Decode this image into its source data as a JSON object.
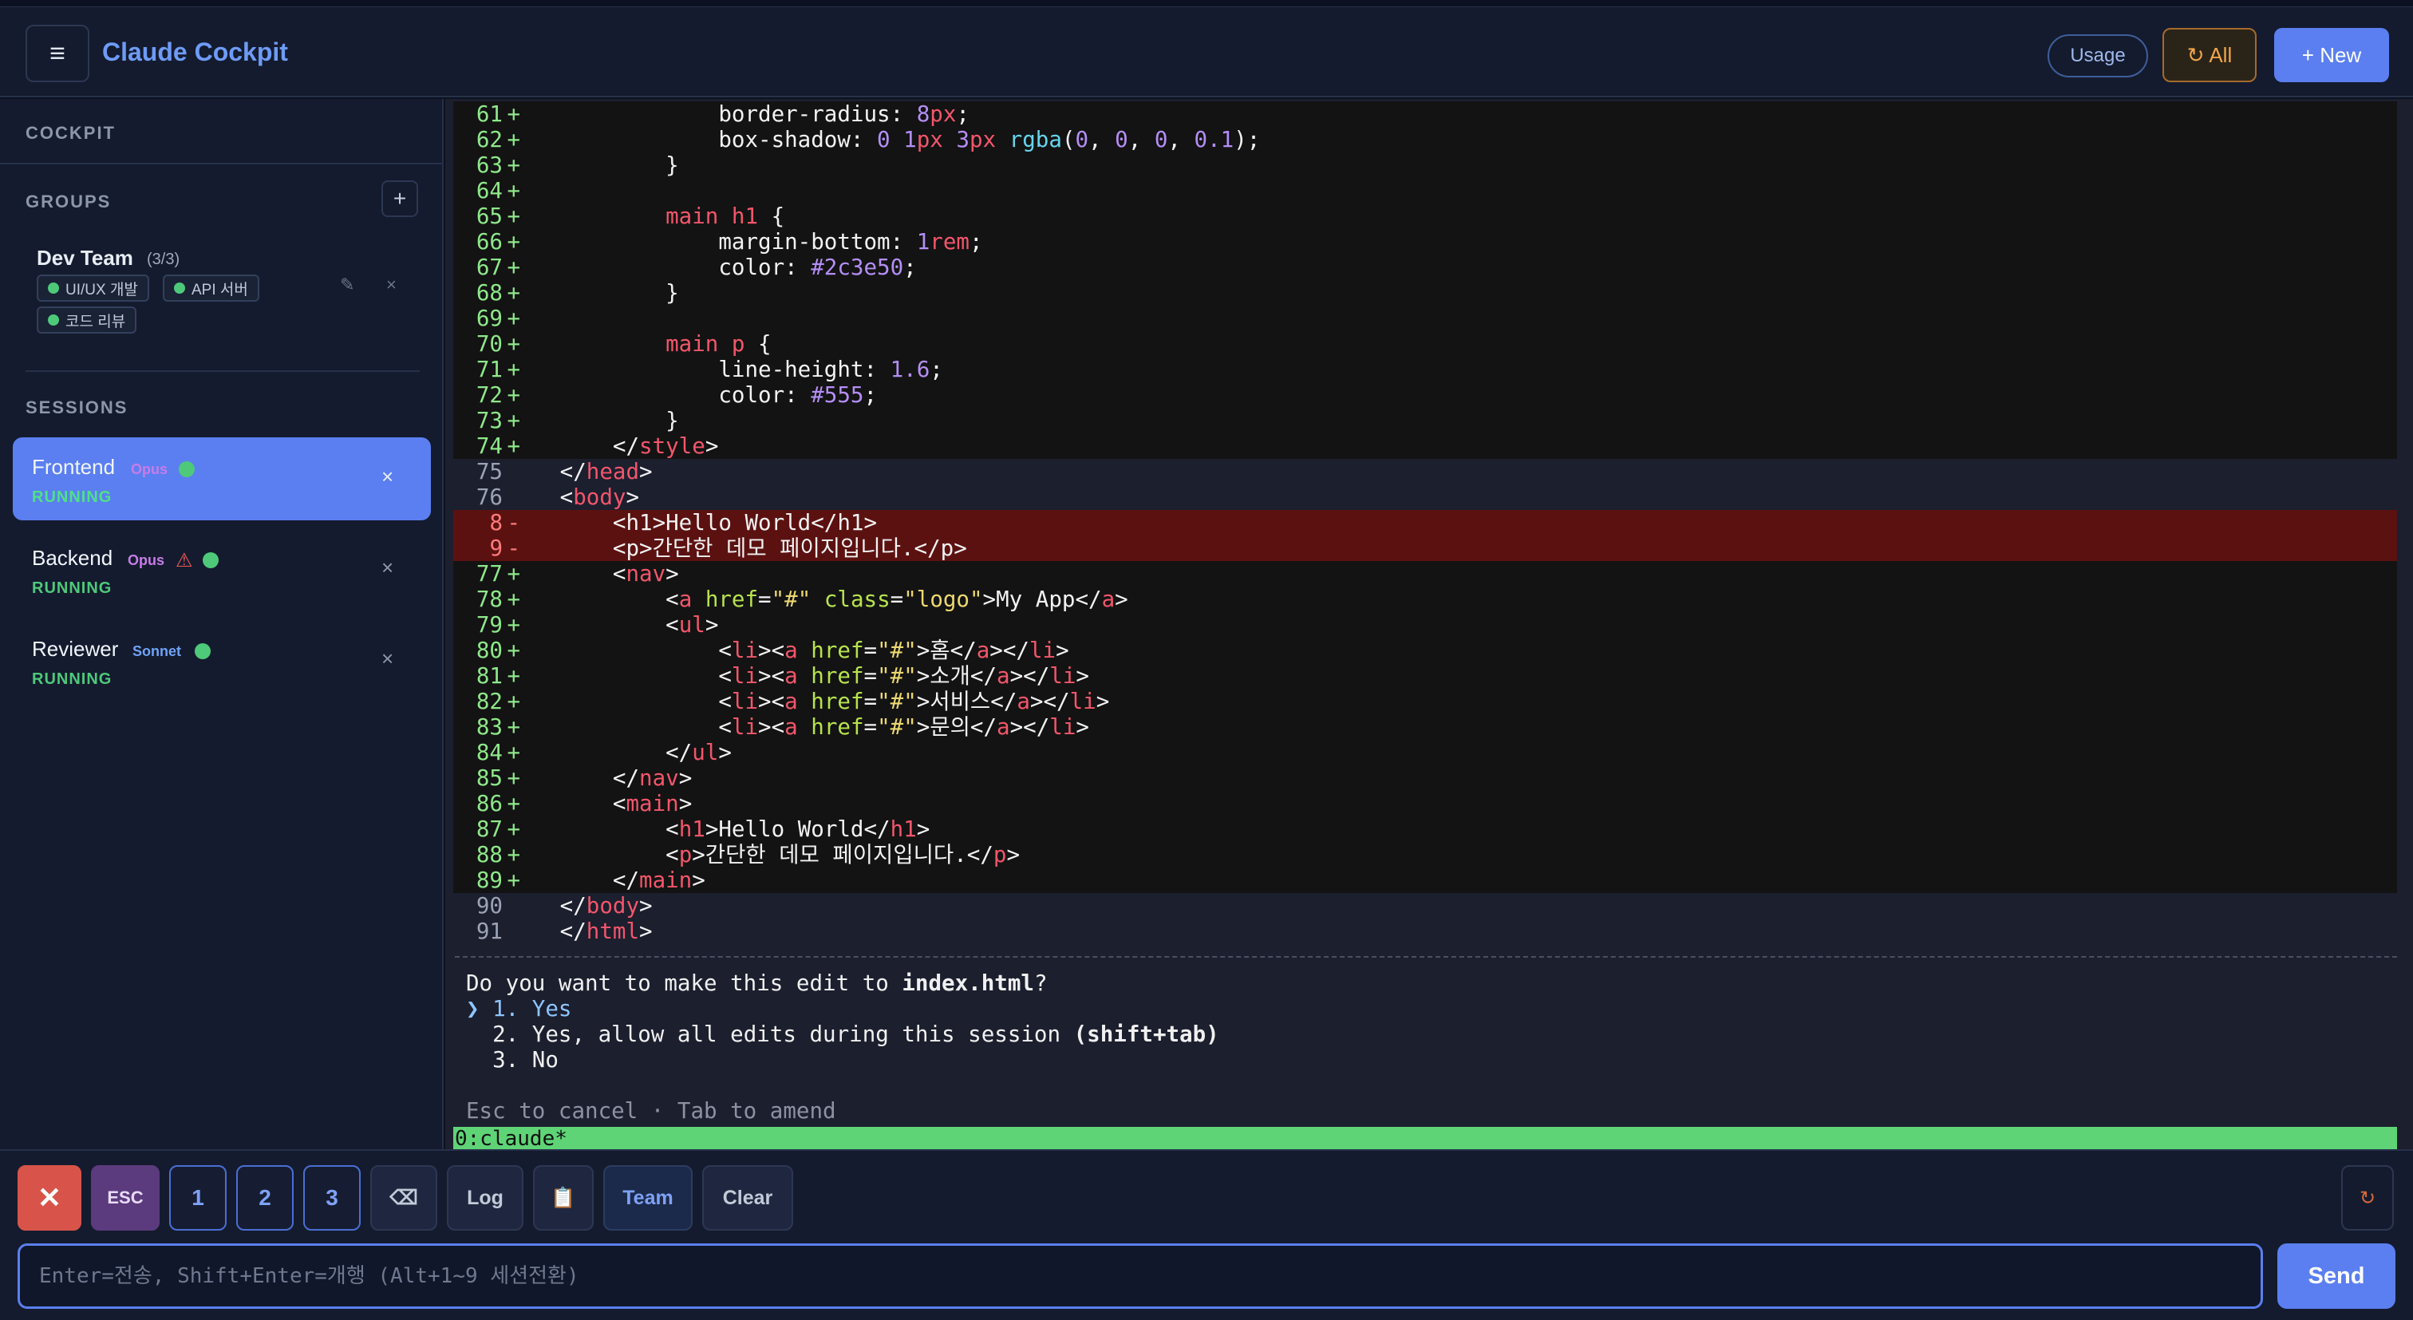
{
  "header": {
    "menu_icon": "menu-icon",
    "title": "Claude Cockpit",
    "usage_label": "Usage",
    "all_label": "↻ All",
    "new_label": "+ New",
    "accent": "#5b7ff0"
  },
  "sidebar": {
    "cockpit_label": "COCKPIT",
    "groups_label": "GROUPS",
    "add_group": "+",
    "group": {
      "name": "Dev Team",
      "count": "(3/3)",
      "chips": [
        "UI/UX 개발",
        "API 서버",
        "코드 리뷰"
      ],
      "edit_icon": "✎",
      "close_icon": "×"
    },
    "sessions_label": "SESSIONS",
    "sessions": [
      {
        "name": "Frontend",
        "model": "Opus",
        "status": "RUNNING",
        "active": true,
        "warning": false
      },
      {
        "name": "Backend",
        "model": "Opus",
        "status": "RUNNING",
        "active": false,
        "warning": true
      },
      {
        "name": "Reviewer",
        "model": "Sonnet",
        "status": "RUNNING",
        "active": false,
        "warning": false
      }
    ],
    "close_icon": "×",
    "warning_icon": "⚠"
  },
  "terminal": {
    "diff_lines": [
      {
        "n": "61",
        "mk": "+",
        "t": "add",
        "segs": [
          [
            "pr",
            "            border-radius: "
          ],
          [
            "nm",
            "8"
          ],
          [
            "ut",
            "px"
          ],
          [
            "pr",
            ";"
          ]
        ]
      },
      {
        "n": "62",
        "mk": "+",
        "t": "add",
        "segs": [
          [
            "pr",
            "            box-shadow: "
          ],
          [
            "nm",
            "0"
          ],
          [
            "pr",
            " "
          ],
          [
            "nm",
            "1"
          ],
          [
            "ut",
            "px"
          ],
          [
            "pr",
            " "
          ],
          [
            "nm",
            "3"
          ],
          [
            "ut",
            "px"
          ],
          [
            "pr",
            " "
          ],
          [
            "fn",
            "rgba"
          ],
          [
            "pr",
            "("
          ],
          [
            "nm",
            "0"
          ],
          [
            "pr",
            ", "
          ],
          [
            "nm",
            "0"
          ],
          [
            "pr",
            ", "
          ],
          [
            "nm",
            "0"
          ],
          [
            "pr",
            ", "
          ],
          [
            "nm",
            "0.1"
          ],
          [
            "pr",
            ");"
          ]
        ]
      },
      {
        "n": "63",
        "mk": "+",
        "t": "add",
        "segs": [
          [
            "pr",
            "        }"
          ]
        ]
      },
      {
        "n": "64",
        "mk": "+",
        "t": "add",
        "segs": [
          [
            "pr",
            ""
          ]
        ]
      },
      {
        "n": "65",
        "mk": "+",
        "t": "add",
        "segs": [
          [
            "pr",
            "        "
          ],
          [
            "tg",
            "main h1"
          ],
          [
            "pr",
            " {"
          ]
        ]
      },
      {
        "n": "66",
        "mk": "+",
        "t": "add",
        "segs": [
          [
            "pr",
            "            margin-bottom: "
          ],
          [
            "nm",
            "1"
          ],
          [
            "ut",
            "rem"
          ],
          [
            "pr",
            ";"
          ]
        ]
      },
      {
        "n": "67",
        "mk": "+",
        "t": "add",
        "segs": [
          [
            "pr",
            "            color: "
          ],
          [
            "nm",
            "#2c3e50"
          ],
          [
            "pr",
            ";"
          ]
        ]
      },
      {
        "n": "68",
        "mk": "+",
        "t": "add",
        "segs": [
          [
            "pr",
            "        }"
          ]
        ]
      },
      {
        "n": "69",
        "mk": "+",
        "t": "add",
        "segs": [
          [
            "pr",
            ""
          ]
        ]
      },
      {
        "n": "70",
        "mk": "+",
        "t": "add",
        "segs": [
          [
            "pr",
            "        "
          ],
          [
            "tg",
            "main p"
          ],
          [
            "pr",
            " {"
          ]
        ]
      },
      {
        "n": "71",
        "mk": "+",
        "t": "add",
        "segs": [
          [
            "pr",
            "            line-height: "
          ],
          [
            "nm",
            "1.6"
          ],
          [
            "pr",
            ";"
          ]
        ]
      },
      {
        "n": "72",
        "mk": "+",
        "t": "add",
        "segs": [
          [
            "pr",
            "            color: "
          ],
          [
            "nm",
            "#555"
          ],
          [
            "pr",
            ";"
          ]
        ]
      },
      {
        "n": "73",
        "mk": "+",
        "t": "add",
        "segs": [
          [
            "pr",
            "        }"
          ]
        ]
      },
      {
        "n": "74",
        "mk": "+",
        "t": "add",
        "segs": [
          [
            "pr",
            "    </"
          ],
          [
            "tg",
            "style"
          ],
          [
            "pr",
            ">"
          ]
        ]
      },
      {
        "n": "75",
        "mk": "",
        "t": "ctx",
        "segs": [
          [
            "pr",
            "</"
          ],
          [
            "tg",
            "head"
          ],
          [
            "pr",
            ">"
          ]
        ]
      },
      {
        "n": "76",
        "mk": "",
        "t": "ctx",
        "segs": [
          [
            "pr",
            "<"
          ],
          [
            "tg",
            "body"
          ],
          [
            "pr",
            ">"
          ]
        ]
      },
      {
        "n": "8",
        "mk": "-",
        "t": "del",
        "segs": [
          [
            "pr",
            "    <h1>Hello World</h1>"
          ]
        ]
      },
      {
        "n": "9",
        "mk": "-",
        "t": "del",
        "segs": [
          [
            "pr",
            "    <p>간단한 데모 페이지입니다.</p>"
          ]
        ]
      },
      {
        "n": "77",
        "mk": "+",
        "t": "add",
        "segs": [
          [
            "pr",
            "    <"
          ],
          [
            "tg",
            "nav"
          ],
          [
            "pr",
            ">"
          ]
        ]
      },
      {
        "n": "78",
        "mk": "+",
        "t": "add",
        "segs": [
          [
            "pr",
            "        <"
          ],
          [
            "tg",
            "a"
          ],
          [
            "pr",
            " "
          ],
          [
            "at",
            "href"
          ],
          [
            "pr",
            "="
          ],
          [
            "st",
            "\"#\""
          ],
          [
            "pr",
            " "
          ],
          [
            "at",
            "class"
          ],
          [
            "pr",
            "="
          ],
          [
            "st",
            "\"logo\""
          ],
          [
            "pr",
            ">My App</"
          ],
          [
            "tg",
            "a"
          ],
          [
            "pr",
            ">"
          ]
        ]
      },
      {
        "n": "79",
        "mk": "+",
        "t": "add",
        "segs": [
          [
            "pr",
            "        <"
          ],
          [
            "tg",
            "ul"
          ],
          [
            "pr",
            ">"
          ]
        ]
      },
      {
        "n": "80",
        "mk": "+",
        "t": "add",
        "segs": [
          [
            "pr",
            "            <"
          ],
          [
            "tg",
            "li"
          ],
          [
            "pr",
            "><"
          ],
          [
            "tg",
            "a"
          ],
          [
            "pr",
            " "
          ],
          [
            "at",
            "href"
          ],
          [
            "pr",
            "="
          ],
          [
            "st",
            "\"#\""
          ],
          [
            "pr",
            ">홈</"
          ],
          [
            "tg",
            "a"
          ],
          [
            "pr",
            "></"
          ],
          [
            "tg",
            "li"
          ],
          [
            "pr",
            ">"
          ]
        ]
      },
      {
        "n": "81",
        "mk": "+",
        "t": "add",
        "segs": [
          [
            "pr",
            "            <"
          ],
          [
            "tg",
            "li"
          ],
          [
            "pr",
            "><"
          ],
          [
            "tg",
            "a"
          ],
          [
            "pr",
            " "
          ],
          [
            "at",
            "href"
          ],
          [
            "pr",
            "="
          ],
          [
            "st",
            "\"#\""
          ],
          [
            "pr",
            ">소개</"
          ],
          [
            "tg",
            "a"
          ],
          [
            "pr",
            "></"
          ],
          [
            "tg",
            "li"
          ],
          [
            "pr",
            ">"
          ]
        ]
      },
      {
        "n": "82",
        "mk": "+",
        "t": "add",
        "segs": [
          [
            "pr",
            "            <"
          ],
          [
            "tg",
            "li"
          ],
          [
            "pr",
            "><"
          ],
          [
            "tg",
            "a"
          ],
          [
            "pr",
            " "
          ],
          [
            "at",
            "href"
          ],
          [
            "pr",
            "="
          ],
          [
            "st",
            "\"#\""
          ],
          [
            "pr",
            ">서비스</"
          ],
          [
            "tg",
            "a"
          ],
          [
            "pr",
            "></"
          ],
          [
            "tg",
            "li"
          ],
          [
            "pr",
            ">"
          ]
        ]
      },
      {
        "n": "83",
        "mk": "+",
        "t": "add",
        "segs": [
          [
            "pr",
            "            <"
          ],
          [
            "tg",
            "li"
          ],
          [
            "pr",
            "><"
          ],
          [
            "tg",
            "a"
          ],
          [
            "pr",
            " "
          ],
          [
            "at",
            "href"
          ],
          [
            "pr",
            "="
          ],
          [
            "st",
            "\"#\""
          ],
          [
            "pr",
            ">문의</"
          ],
          [
            "tg",
            "a"
          ],
          [
            "pr",
            "></"
          ],
          [
            "tg",
            "li"
          ],
          [
            "pr",
            ">"
          ]
        ]
      },
      {
        "n": "84",
        "mk": "+",
        "t": "add",
        "segs": [
          [
            "pr",
            "        </"
          ],
          [
            "tg",
            "ul"
          ],
          [
            "pr",
            ">"
          ]
        ]
      },
      {
        "n": "85",
        "mk": "+",
        "t": "add",
        "segs": [
          [
            "pr",
            "    </"
          ],
          [
            "tg",
            "nav"
          ],
          [
            "pr",
            ">"
          ]
        ]
      },
      {
        "n": "86",
        "mk": "+",
        "t": "add",
        "segs": [
          [
            "pr",
            "    <"
          ],
          [
            "tg",
            "main"
          ],
          [
            "pr",
            ">"
          ]
        ]
      },
      {
        "n": "87",
        "mk": "+",
        "t": "add",
        "segs": [
          [
            "pr",
            "        <"
          ],
          [
            "tg",
            "h1"
          ],
          [
            "pr",
            ">Hello World</"
          ],
          [
            "tg",
            "h1"
          ],
          [
            "pr",
            ">"
          ]
        ]
      },
      {
        "n": "88",
        "mk": "+",
        "t": "add",
        "segs": [
          [
            "pr",
            "        <"
          ],
          [
            "tg",
            "p"
          ],
          [
            "pr",
            ">간단한 데모 페이지입니다.</"
          ],
          [
            "tg",
            "p"
          ],
          [
            "pr",
            ">"
          ]
        ]
      },
      {
        "n": "89",
        "mk": "+",
        "t": "add",
        "segs": [
          [
            "pr",
            "    </"
          ],
          [
            "tg",
            "main"
          ],
          [
            "pr",
            ">"
          ]
        ]
      },
      {
        "n": "90",
        "mk": "",
        "t": "ctx",
        "segs": [
          [
            "pr",
            "</"
          ],
          [
            "tg",
            "body"
          ],
          [
            "pr",
            ">"
          ]
        ]
      },
      {
        "n": "91",
        "mk": "",
        "t": "ctx",
        "segs": [
          [
            "pr",
            "</"
          ],
          [
            "tg",
            "html"
          ],
          [
            "pr",
            ">"
          ]
        ]
      }
    ],
    "question_prefix": "Do you want to make this edit to ",
    "question_file": "index.html",
    "question_suffix": "?",
    "options": [
      {
        "pointer": "❯ ",
        "text": "1. Yes",
        "bold": ""
      },
      {
        "pointer": "  ",
        "text": "2. Yes, allow all edits during this session ",
        "bold": "(shift+tab)"
      },
      {
        "pointer": "  ",
        "text": "3. No",
        "bold": ""
      }
    ],
    "hint": "Esc to cancel · Tab to amend",
    "status_line": "0:claude*"
  },
  "bottombar": {
    "buttons": [
      "✕",
      "ESC",
      "1",
      "2",
      "3",
      "⌫",
      "Log",
      "📋",
      "Team",
      "Clear"
    ],
    "refresh": "↻",
    "input_placeholder": "Enter=전송, Shift+Enter=개행 (Alt+1~9 세션전환)",
    "input_value": "",
    "send_label": "Send"
  }
}
